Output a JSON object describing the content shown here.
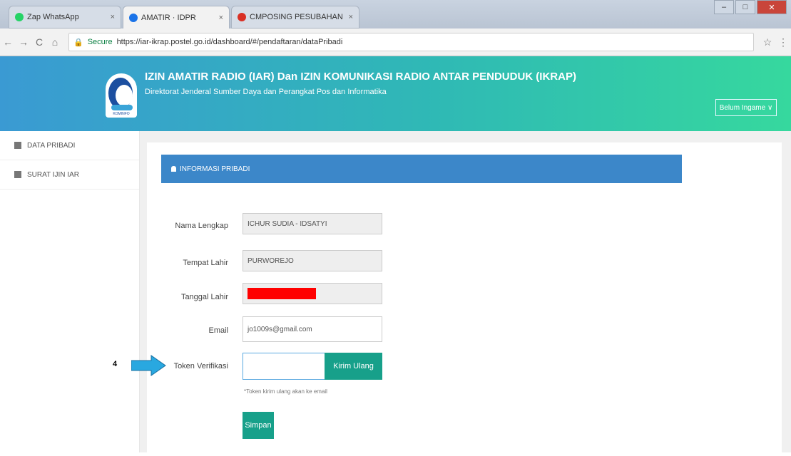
{
  "browser": {
    "tabs": [
      {
        "label": "Zap WhatsApp",
        "favicon_color": "#25d366"
      },
      {
        "label": "AMATIR · IDPR",
        "favicon_color": "#1a73e8"
      },
      {
        "label": "CMPOSING PESUBAHAN",
        "favicon_color": "#d93025"
      }
    ],
    "window_controls": {
      "min": "–",
      "max": "□",
      "close": "✕"
    },
    "nav": {
      "back": "←",
      "forward": "→",
      "reload": "C",
      "home": "⌂"
    },
    "secure_label": "Secure",
    "url": "https://iar-ikrap.postel.go.id/dashboard/#/pendaftaran/dataPribadi"
  },
  "header": {
    "logo_text": "KOMINFO",
    "title": "IZIN AMATIR RADIO (IAR) Dan IZIN KOMUNIKASI RADIO ANTAR PENDUDUK (IKRAP)",
    "subtitle": "Direktorat Jenderal Sumber Daya dan Perangkat Pos dan Informatika",
    "user_button": "Belum Ingame ∨"
  },
  "sidebar": {
    "items": [
      {
        "label": "DATA PRIBADI"
      },
      {
        "label": "SURAT IJIN IAR"
      }
    ]
  },
  "panel": {
    "heading": "INFORMASI PRIBADI"
  },
  "form": {
    "fields": [
      {
        "label": "Nama Lengkap",
        "value": "ICHUR SUDIA - IDSATYI"
      },
      {
        "label": "Tempat Lahir",
        "value": "PURWOREJO"
      },
      {
        "label": "Tanggal Lahir",
        "value": ""
      },
      {
        "label": "Email",
        "value": "jo1009s@gmail.com"
      },
      {
        "label": "Token Verifikasi",
        "value": ""
      }
    ],
    "send_button": "Kirim Ulang",
    "hint": "*Token kirim ulang akan ke email",
    "save_button": "Simpan"
  },
  "annotation": {
    "step": "4",
    "arrow_color": "#29a8e0"
  }
}
